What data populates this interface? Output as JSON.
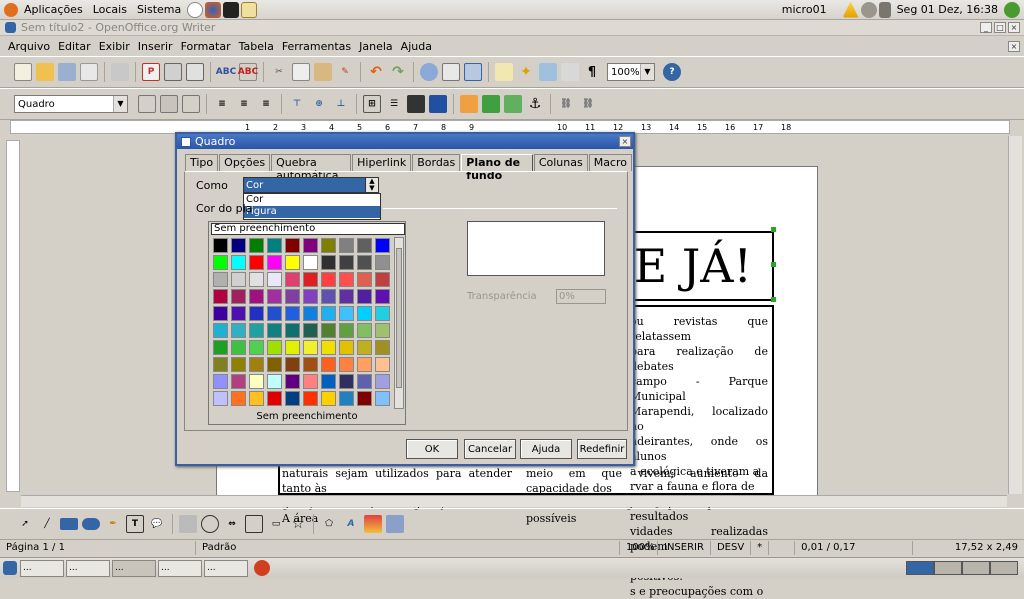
{
  "panel": {
    "menus": [
      "Aplicações",
      "Locais",
      "Sistema"
    ],
    "user": "micro01",
    "datetime": "Seg 01 Dez, 16:38"
  },
  "window": {
    "title": "Sem título2 - OpenOffice.org Writer"
  },
  "menubar": [
    "Arquivo",
    "Editar",
    "Exibir",
    "Inserir",
    "Formatar",
    "Tabela",
    "Ferramentas",
    "Janela",
    "Ajuda"
  ],
  "toolbar": {
    "zoom": "100%"
  },
  "formatting": {
    "style": "Quadro"
  },
  "ruler": {
    "marks": [
      "1",
      "2",
      "3",
      "4",
      "5",
      "6",
      "7",
      "8",
      "9",
      "10",
      "11",
      "12",
      "13",
      "14",
      "15",
      "16",
      "17",
      "18"
    ]
  },
  "document": {
    "heading": "TE JÁ!",
    "right_lines": [
      "ou revistas que relatassem",
      "para realização de debates",
      "campo - Parque Municipal",
      "Marapendi, localizado no",
      "ndeirantes, onde os alunos",
      "a ecológica e tiveram a",
      "rvar a fauna e flora de",
      "manguezal. Os resultados",
      "vidades realizadas podem",
      "eguintes pontos positivos:",
      "s e preocupações com o",
      "meio em que vivem; aumento da capacidade dos",
      "alunos em interagir e opinar quanto aos possíveis"
    ],
    "left_lines": [
      "naturais sejam utilizados para atender tanto às",
      "gerações atuais, como gerações futuras. A área"
    ]
  },
  "dialog": {
    "title": "Quadro",
    "tabs": [
      "Tipo",
      "Opções",
      "Quebra automática",
      "Hiperlink",
      "Bordas",
      "Plano de fundo",
      "Colunas",
      "Macro"
    ],
    "active_tab": "Plano de fundo",
    "como_label": "Como",
    "como_value": "Cor",
    "como_options": [
      "Cor",
      "Figura"
    ],
    "highlighted_option": "Figura",
    "cor_label": "Cor do pla",
    "palette_top": "Sem preenchimento",
    "palette_bottom": "Sem preenchimento",
    "transparency_label": "Transparência",
    "transparency_value": "0%",
    "buttons": {
      "ok": "OK",
      "cancel": "Cancelar",
      "help": "Ajuda",
      "reset": "Redefinir"
    },
    "palette_colors": [
      "#000000",
      "#000080",
      "#008000",
      "#008080",
      "#800000",
      "#800080",
      "#808000",
      "#808080",
      "#606060",
      "#0000ff",
      "#00ff00",
      "#00ffff",
      "#ff0000",
      "#ff00ff",
      "#ffff00",
      "#ffffff",
      "#303030",
      "#404040",
      "#505050",
      "#909090",
      "#b0b0b0",
      "#d0d0d0",
      "#e0e0e0",
      "#e8e8f8",
      "#e04070",
      "#e02020",
      "#ff4040",
      "#ff5050",
      "#e06050",
      "#c04040",
      "#b00040",
      "#a02060",
      "#a01080",
      "#a030a0",
      "#8040a0",
      "#8040c0",
      "#6050b0",
      "#6030a0",
      "#5020a0",
      "#6010b0",
      "#4000a0",
      "#5010b0",
      "#2030c0",
      "#2050d0",
      "#2060e0",
      "#1080e0",
      "#20b0f0",
      "#40c0ff",
      "#00d0ff",
      "#20d0e0",
      "#20b0d0",
      "#30b0c0",
      "#20a0a0",
      "#108080",
      "#107070",
      "#206050",
      "#508030",
      "#60a040",
      "#80c060",
      "#a0c070",
      "#20a020",
      "#40c040",
      "#50d050",
      "#a0e000",
      "#e0f000",
      "#f0f030",
      "#f0e000",
      "#e0c000",
      "#c0b020",
      "#a09020",
      "#808020",
      "#908000",
      "#a08010",
      "#806000",
      "#804010",
      "#a05010",
      "#ff6020",
      "#ff8040",
      "#ffa060",
      "#ffc090",
      "#9090ff",
      "#b04080",
      "#ffffc0",
      "#c0ffff",
      "#600080",
      "#ff8080",
      "#0060c0",
      "#303060",
      "#6060b0",
      "#a0a0e0",
      "#c0c0ff",
      "#ff7020",
      "#ffc020",
      "#e00000",
      "#004080",
      "#ff3000",
      "#ffd000",
      "#2080c0",
      "#800000",
      "#80c0ff"
    ]
  },
  "statusbar": {
    "page": "Página 1 / 1",
    "style": "Padrão",
    "zoom": "100%",
    "insert": "INSERIR",
    "sel": "DESV",
    "star": "*",
    "position": "0,01 / 0,17",
    "size": "17,52 x 2,49"
  },
  "taskbar": {
    "items": [
      "...",
      "...",
      "...",
      "...",
      "...",
      "..."
    ]
  }
}
